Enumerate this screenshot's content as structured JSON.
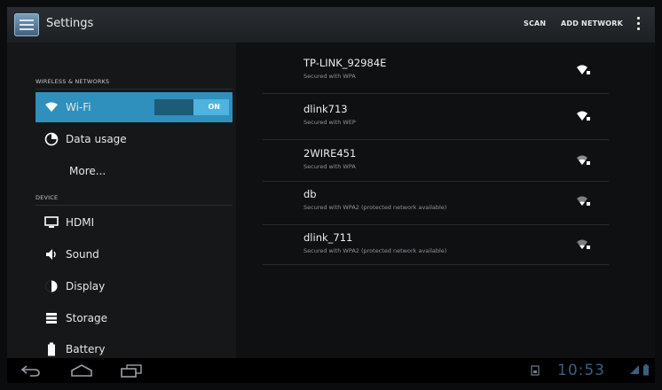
{
  "actionbar": {
    "title": "Settings",
    "actions": {
      "scan": "SCAN",
      "add_network": "ADD NETWORK"
    },
    "icons": {
      "app": "settings-app-icon",
      "overflow": "overflow-menu-icon"
    }
  },
  "sidebar": {
    "sections": {
      "wireless": "WIRELESS & NETWORKS",
      "device": "DEVICE"
    },
    "items": [
      {
        "label": "Wi-Fi",
        "icon": "wifi-icon",
        "selected": true,
        "toggle": "ON"
      },
      {
        "label": "Data usage",
        "icon": "data-usage-icon"
      },
      {
        "label": "More..."
      },
      {
        "label": "HDMI",
        "icon": "hdmi-icon"
      },
      {
        "label": "Sound",
        "icon": "sound-icon"
      },
      {
        "label": "Display",
        "icon": "display-icon"
      },
      {
        "label": "Storage",
        "icon": "storage-icon"
      },
      {
        "label": "Battery",
        "icon": "battery-icon"
      }
    ]
  },
  "networks": [
    {
      "ssid": "TP-LINK_92984E",
      "security": "Secured with WPA",
      "signal": "strong"
    },
    {
      "ssid": "dlink713",
      "security": "Secured with WEP",
      "signal": "strong"
    },
    {
      "ssid": "2WIRE451",
      "security": "Secured with WPA",
      "signal": "medium"
    },
    {
      "ssid": "db",
      "security": "Secured with WPA2 (protected network available)",
      "signal": "weak"
    },
    {
      "ssid": "dlink_711",
      "security": "Secured with WPA2 (protected network available)",
      "signal": "weak"
    }
  ],
  "systembar": {
    "clock": "10:53",
    "icons": [
      "back-icon",
      "home-icon",
      "recent-apps-icon",
      "notification-icon",
      "wifi-status-icon",
      "battery-status-icon"
    ]
  },
  "colors": {
    "accent": "#2f8fbd",
    "toggle_on": "#4fb3df",
    "clock": "#3c5f80"
  }
}
